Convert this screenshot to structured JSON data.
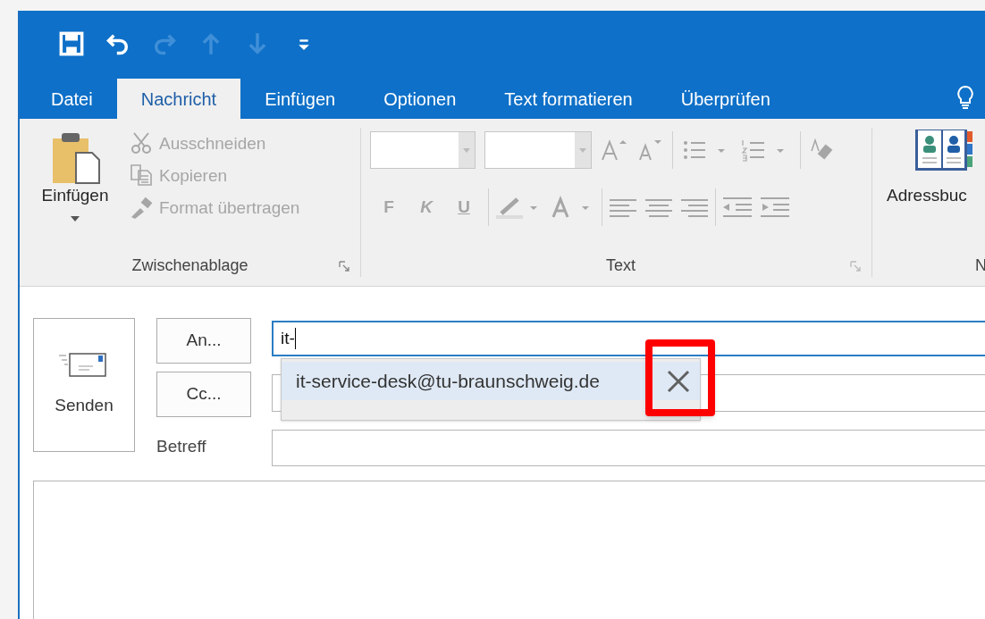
{
  "quick_access": [
    {
      "kind": "save",
      "disabled": false
    },
    {
      "kind": "undo",
      "disabled": false
    },
    {
      "kind": "redo",
      "disabled": true
    },
    {
      "kind": "up",
      "disabled": true
    },
    {
      "kind": "down",
      "disabled": true
    },
    {
      "kind": "customize",
      "disabled": false
    }
  ],
  "tabs": [
    {
      "label": "Datei",
      "selected": false
    },
    {
      "label": "Nachricht",
      "selected": true
    },
    {
      "label": "Einfügen",
      "selected": false
    },
    {
      "label": "Optionen",
      "selected": false
    },
    {
      "label": "Text formatieren",
      "selected": false
    },
    {
      "label": "Überprüfen",
      "selected": false
    }
  ],
  "clipboard": {
    "label": "Zwischenablage",
    "paste": {
      "label": "Einfügen",
      "disabled": false
    },
    "items": [
      {
        "kind": "cut",
        "label": "Ausschneiden",
        "disabled": true
      },
      {
        "kind": "copy",
        "label": "Kopieren",
        "disabled": true
      },
      {
        "kind": "painter",
        "label": "Format übertragen",
        "disabled": true
      }
    ]
  },
  "text_group": {
    "label": "Text",
    "disabled": true,
    "format_buttons": [
      {
        "kind": "bold",
        "label": "F"
      },
      {
        "kind": "italic",
        "label": "K"
      },
      {
        "kind": "underline",
        "label": "U"
      }
    ]
  },
  "names_group": {
    "address_book": "Adressbuc",
    "label": "N"
  },
  "compose": {
    "send": "Senden",
    "to_button": "An...",
    "to_value": "it-",
    "cc_button": "Cc...",
    "subject_label": "Betreff",
    "suggestions": [
      {
        "address": "it-service-desk@tu-braunschweig.de",
        "selected": true,
        "remove_highlighted": true
      }
    ]
  }
}
